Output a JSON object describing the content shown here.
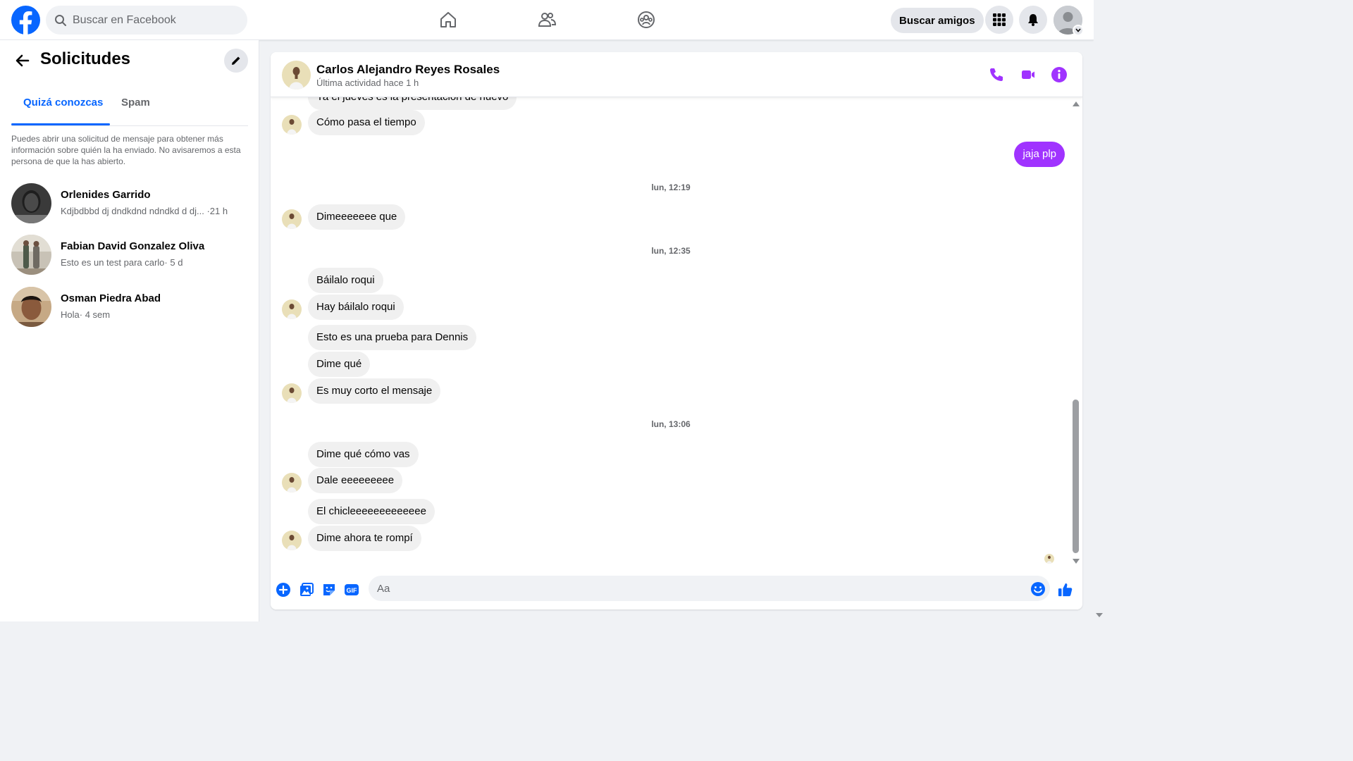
{
  "topbar": {
    "search_placeholder": "Buscar en Facebook",
    "find_friends_label": "Buscar amigos",
    "nav_icons": [
      "home-icon",
      "friends-icon",
      "groups-icon"
    ],
    "brand_color": "#0866ff"
  },
  "left_panel": {
    "title": "Solicitudes",
    "tabs": [
      {
        "label": "Quizá conozcas",
        "active": true
      },
      {
        "label": "Spam",
        "active": false
      }
    ],
    "info_text": "Puedes abrir una solicitud de mensaje para obtener más información sobre quién la ha enviado. No avisaremos a esta persona de que la has abierto.",
    "requests": [
      {
        "name": "Orlenides Garrido",
        "preview": "Kdjbdbbd dj dndkdnd ndndkd d dj...",
        "time": "·21 h"
      },
      {
        "name": "Fabian David Gonzalez Oliva",
        "preview": "Esto es un test para carlo",
        "time": "· 5 d"
      },
      {
        "name": "Osman Piedra Abad",
        "preview": "Hola",
        "time": "· 4 sem"
      }
    ]
  },
  "chat": {
    "contact_name": "Carlos Alejandro Reyes Rosales",
    "status": "Última actividad hace 1 h",
    "accent_color": "#a033ff",
    "clipped_message": "Ya el jueves es la presentación de nuevo",
    "messages_a": [
      "Cómo pasa el tiempo"
    ],
    "outgoing": "jaja plp",
    "time_1": "lun, 12:19",
    "messages_b": [
      "Dimeeeeeee que"
    ],
    "time_2": "lun, 12:35",
    "messages_c": [
      "Báilalo roqui",
      "Hay báilalo roqui",
      "Esto es una prueba para Dennis",
      "Dime qué",
      "Es muy corto el mensaje"
    ],
    "time_3": "lun, 13:06",
    "messages_d": [
      "Dime qué cómo vas",
      "Dale eeeeeeeee",
      "El chicleeeeeeeeeeeee",
      "Dime ahora te rompí"
    ],
    "composer_placeholder": "Aa"
  }
}
